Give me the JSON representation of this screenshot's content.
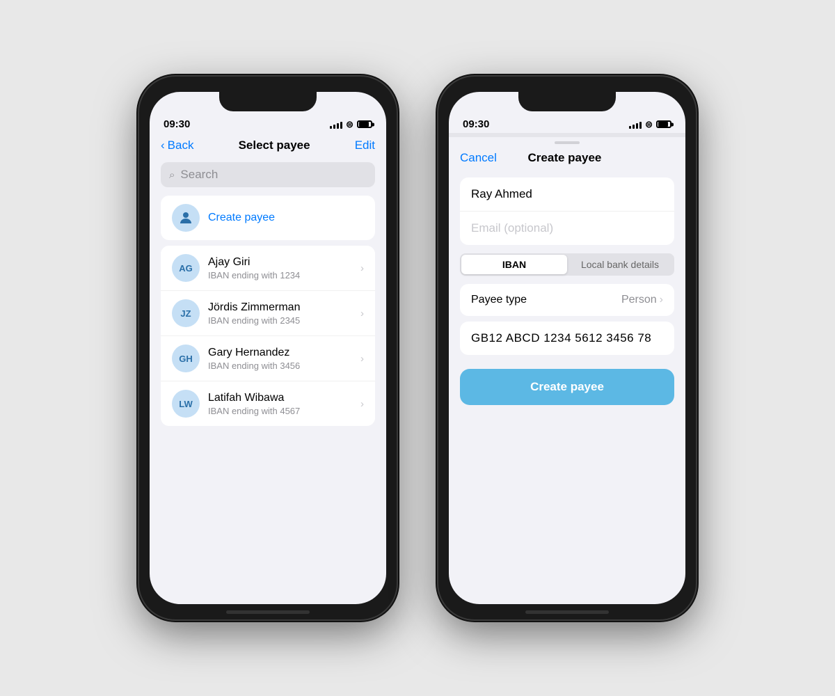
{
  "phone1": {
    "status": {
      "time": "09:30",
      "signal_bars": [
        4,
        6,
        8,
        10,
        12
      ],
      "wifi": "wifi",
      "battery": "battery"
    },
    "nav": {
      "back_label": "Back",
      "title": "Select payee",
      "action_label": "Edit"
    },
    "search": {
      "placeholder": "Search",
      "icon": "🔍"
    },
    "create_section": {
      "label": "Create payee"
    },
    "payees": [
      {
        "initials": "AG",
        "name": "Ajay Giri",
        "subtitle": "IBAN ending with 1234"
      },
      {
        "initials": "JZ",
        "name": "Jördis Zimmerman",
        "subtitle": "IBAN ending with 2345"
      },
      {
        "initials": "GH",
        "name": "Gary Hernandez",
        "subtitle": "IBAN ending with 3456"
      },
      {
        "initials": "LW",
        "name": "Latifah Wibawa",
        "subtitle": "IBAN ending with 4567"
      }
    ]
  },
  "phone2": {
    "status": {
      "time": "09:30"
    },
    "nav": {
      "cancel_label": "Cancel",
      "title": "Create payee"
    },
    "form": {
      "name_value": "Ray Ahmed",
      "email_placeholder": "Email (optional)"
    },
    "segment": {
      "iban_label": "IBAN",
      "local_label": "Local bank details",
      "active": "iban"
    },
    "payee_type": {
      "label": "Payee type",
      "value": "Person"
    },
    "iban_value": "GB12 ABCD 1234 5612 3456 78",
    "create_button_label": "Create payee"
  }
}
